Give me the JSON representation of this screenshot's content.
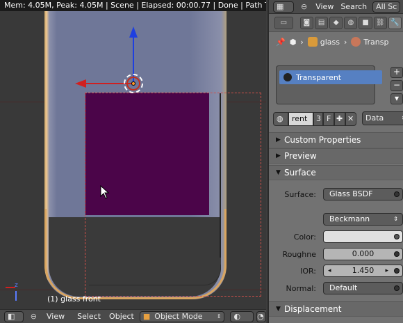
{
  "statusbar": {
    "text": "Mem: 4.05M, Peak: 4.05M | Scene | Elapsed: 00:00.77 | Done | Path Tracin"
  },
  "viewport": {
    "object_info": "(1) glass front",
    "axis_label": "z"
  },
  "view_header": {
    "menus": [
      "View",
      "Select",
      "Object"
    ],
    "mode": "Object Mode"
  },
  "props_header": {
    "menus": [
      "View",
      "Search"
    ],
    "filter": "All Sc"
  },
  "breadcrumb": {
    "object": "glass",
    "material": "Transp"
  },
  "material_slots": {
    "items": [
      "Transparent"
    ]
  },
  "material_datablock": {
    "name": "rent",
    "users": "3",
    "fake_user": "F",
    "link": "Data"
  },
  "panels": {
    "custom_properties": "Custom Properties",
    "preview": "Preview",
    "surface": "Surface",
    "displacement": "Displacement"
  },
  "surface": {
    "surface_label": "Surface:",
    "surface_value": "Glass BSDF",
    "distribution": "Beckmann",
    "color_label": "Color:",
    "roughness_label": "Roughne",
    "roughness_value": "0.000",
    "ior_label": "IOR:",
    "ior_value": "1.450",
    "normal_label": "Normal:",
    "normal_value": "Default"
  },
  "colors": {
    "viewport_bg": "#393939",
    "plane": "#4b0549",
    "selection": "#d0504a",
    "slot_highlight": "#5680c2",
    "gizmo_z": "#1e3fe0",
    "gizmo_x": "#d02020"
  }
}
